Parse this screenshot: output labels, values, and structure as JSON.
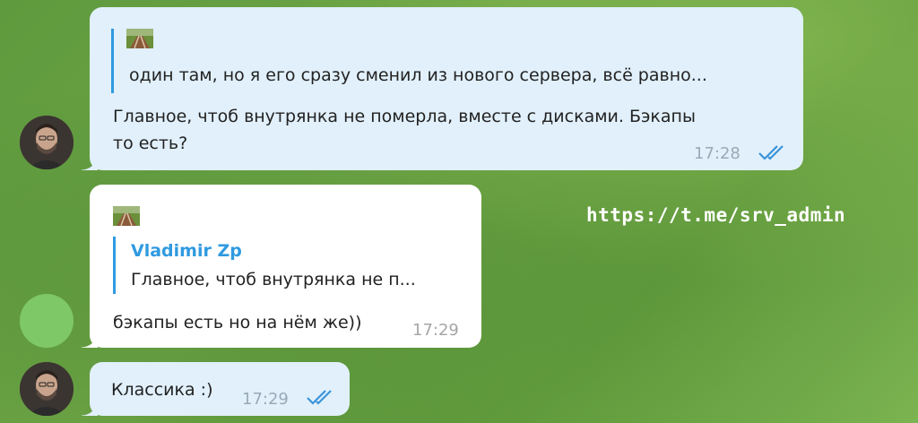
{
  "watermark": "https://t.me/srv_admin",
  "messages": [
    {
      "direction": "outgoing",
      "reply": {
        "preview": "один там, но я его сразу сменил из нового сервера, всё равно..."
      },
      "text_line1": "Главное, чтоб внутрянка не померла, вместе с дисками. Бэкапы",
      "text_line2": "то есть?",
      "time": "17:28",
      "read": true
    },
    {
      "direction": "incoming",
      "reply": {
        "author": "Vladimir Zp",
        "preview": "Главное, чтоб внутрянка не п..."
      },
      "text": "бэкапы есть но на нём же))",
      "time": "17:29"
    },
    {
      "direction": "outgoing",
      "text": "Классика :)",
      "time": "17:29",
      "read": true
    }
  ],
  "colors": {
    "outgoing_bubble": "#e1f0fb",
    "incoming_bubble": "#ffffff",
    "accent": "#2f9ae0"
  },
  "icons": [
    "railway-thumbnail-icon",
    "double-check-icon"
  ]
}
